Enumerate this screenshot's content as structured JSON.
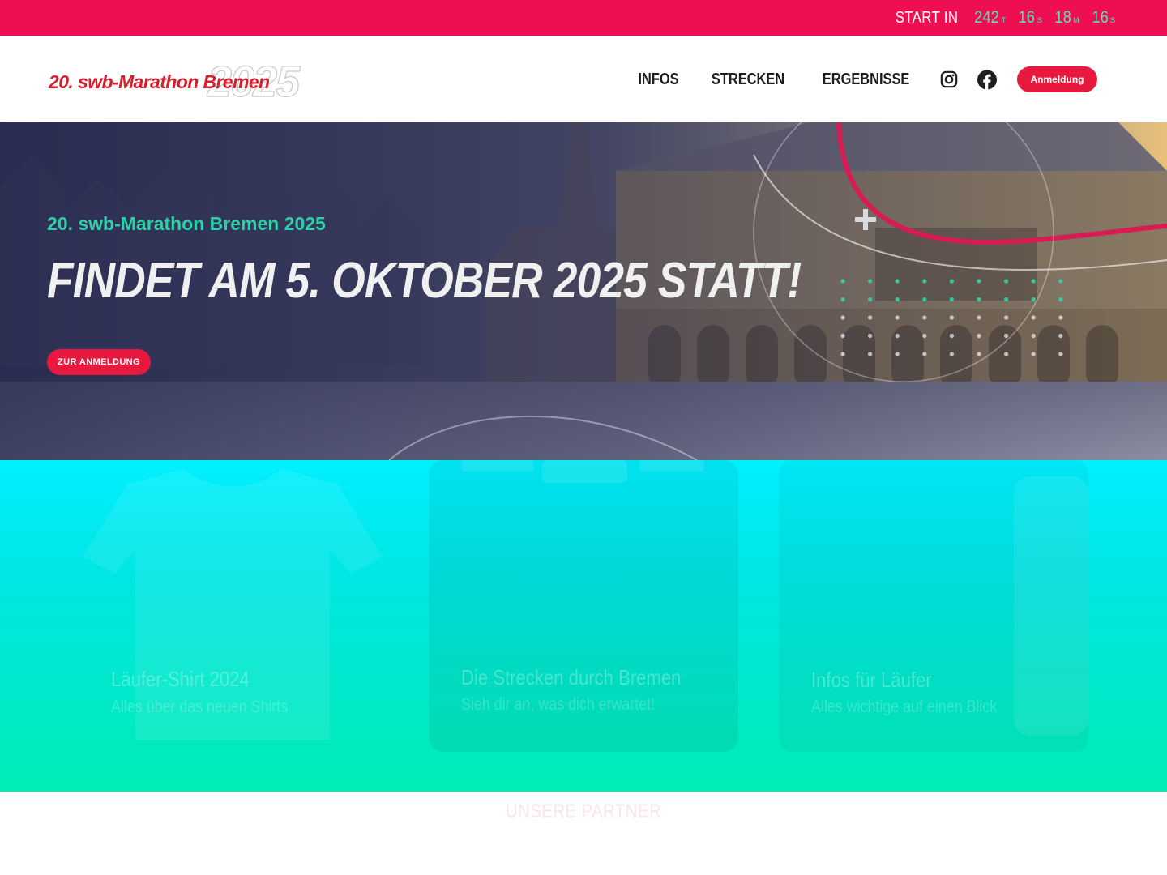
{
  "countdown": {
    "label": "START IN",
    "items": [
      {
        "value": "242",
        "unit": "T"
      },
      {
        "value": "16",
        "unit": "S"
      },
      {
        "value": "18",
        "unit": "M"
      },
      {
        "value": "16",
        "unit": "S"
      }
    ]
  },
  "header": {
    "logo_name": "20. swb-Marathon Bremen",
    "logo_year": "2025",
    "nav": [
      {
        "label": "INFOS"
      },
      {
        "label": "STRECKEN"
      },
      {
        "label": "ERGEBNISSE"
      }
    ],
    "social_icons": [
      "instagram-icon",
      "facebook-icon"
    ],
    "cta_label": "Anmeldung"
  },
  "hero": {
    "subtitle": "20. swb-Marathon Bremen 2025",
    "title": "FINDET AM 5. OKTOBER 2025 STATT!",
    "button_label": "ZUR ANMELDUNG"
  },
  "teasers": [
    {
      "title": "Läufer-Shirt 2024",
      "subtitle": "Alles über das neuen Shirts"
    },
    {
      "title": "Die Strecken durch Bremen",
      "subtitle": "Sieh dir an, was dich erwartet!"
    },
    {
      "title": "Infos für Läufer",
      "subtitle": "Alles wichtige auf einen Blick"
    }
  ],
  "partner_heading": "UNSERE PARTNER",
  "colors": {
    "brand_red": "#ee0f53",
    "accent_green": "#2ed0a6",
    "teaser_cyan": "#00f0ff"
  }
}
